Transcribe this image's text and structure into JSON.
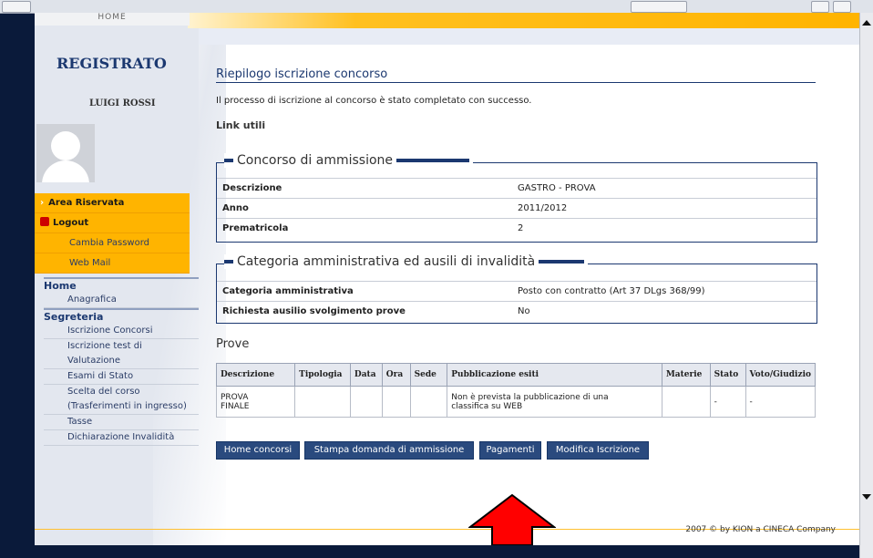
{
  "header": {
    "home_tab": "HOME"
  },
  "sidebar": {
    "title": "REGISTRATO",
    "user_name": "LUIGI ROSSI",
    "menu": [
      {
        "label": "Area Riservata",
        "icon": "chevron-right-icon"
      },
      {
        "label": "Logout",
        "icon": "lock-icon"
      },
      {
        "label": "Cambia Password"
      },
      {
        "label": "Web Mail"
      }
    ],
    "nav": {
      "home": "Home",
      "anagrafica": "Anagrafica",
      "segreteria": "Segreteria",
      "items": [
        "Iscrizione Concorsi",
        "Iscrizione test di",
        "Valutazione",
        "Esami di Stato",
        "Scelta del corso",
        "(Trasferimenti in ingresso)",
        "Tasse",
        "Dichiarazione Invalidità"
      ]
    }
  },
  "main": {
    "title": "Riepilogo iscrizione concorso",
    "message": "Il processo di iscrizione al concorso è stato completato con successo.",
    "links_label": "Link utili",
    "concorso": {
      "legend": "Concorso di ammissione",
      "rows": [
        {
          "label": "Descrizione",
          "value": "GASTRO - PROVA"
        },
        {
          "label": "Anno",
          "value": "2011/2012"
        },
        {
          "label": "Prematricola",
          "value": "2"
        }
      ]
    },
    "categoria": {
      "legend": "Categoria amministrativa ed ausili di invalidità",
      "rows": [
        {
          "label": "Categoria amministrativa",
          "value": "Posto con contratto (Art 37 DLgs 368/99)"
        },
        {
          "label": "Richiesta ausilio svolgimento prove",
          "value": "No"
        }
      ]
    },
    "prove": {
      "title": "Prove",
      "columns": [
        "Descrizione",
        "Tipologia",
        "Data",
        "Ora",
        "Sede",
        "Pubblicazione esiti",
        "Materie",
        "Stato",
        "Voto/Giudizio"
      ],
      "row": {
        "descrizione_1": "PROVA",
        "descrizione_2": "FINALE",
        "pubblicazione_1": "Non è prevista la pubblicazione di una",
        "pubblicazione_2": "classifica su WEB",
        "stato": "-",
        "voto": "-"
      }
    },
    "buttons": [
      "Home concorsi",
      "Stampa domanda di ammissione",
      "Pagamenti",
      "Modifica Iscrizione"
    ]
  },
  "footer": {
    "text": "2007 © by KION a CINECA Company"
  },
  "colors": {
    "accent_orange": "#ffb400",
    "navy": "#1b3870",
    "button": "#2a4a7e",
    "annotation_arrow": "#ff0000"
  }
}
